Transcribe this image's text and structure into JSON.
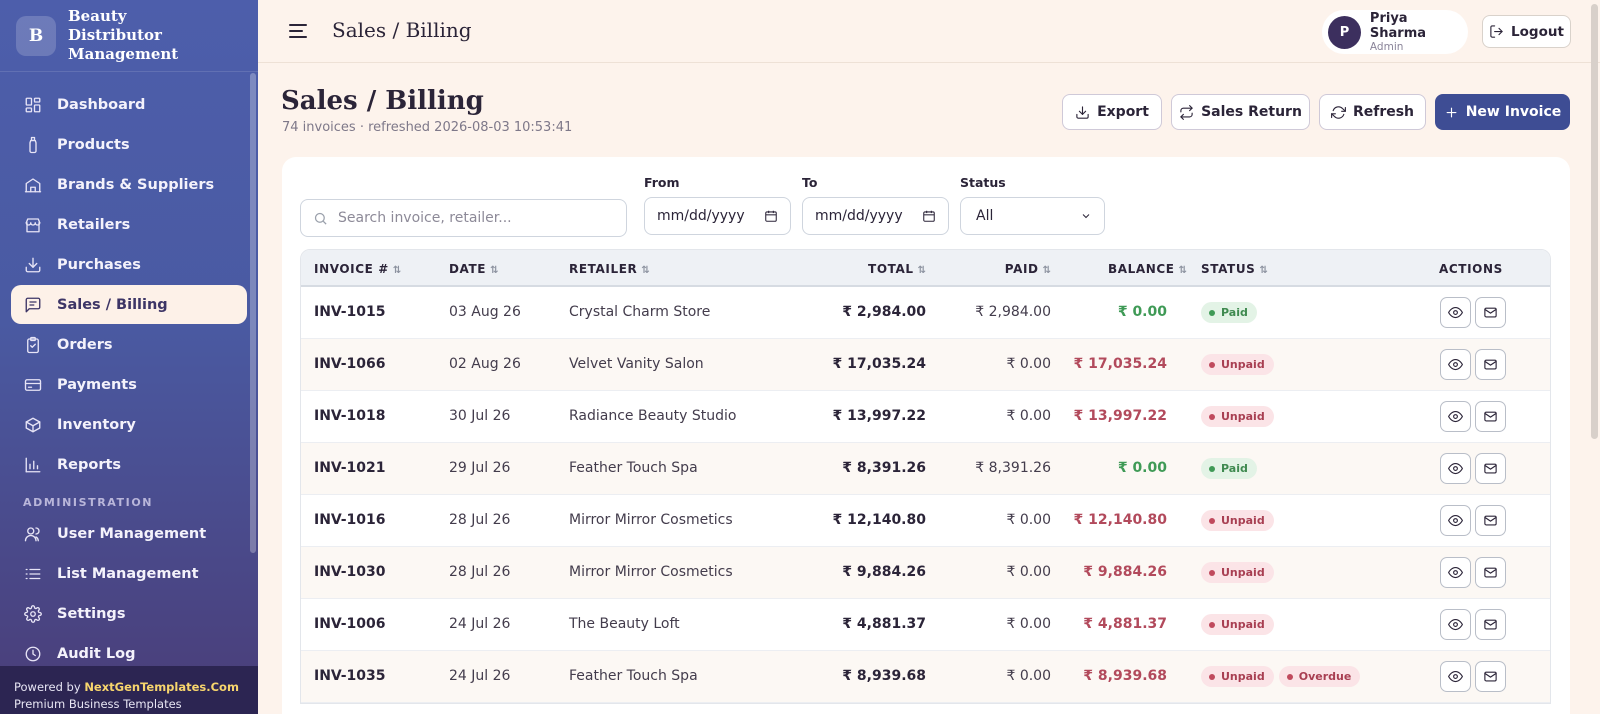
{
  "brand": {
    "logo_letter": "B",
    "name": "Beauty Distributor Management"
  },
  "sidebar": {
    "items": [
      {
        "label": "Dashboard",
        "icon": "grid-icon"
      },
      {
        "label": "Products",
        "icon": "bottle-icon"
      },
      {
        "label": "Brands & Suppliers",
        "icon": "building-icon"
      },
      {
        "label": "Retailers",
        "icon": "store-icon"
      },
      {
        "label": "Purchases",
        "icon": "download-icon"
      },
      {
        "label": "Sales / Billing",
        "icon": "receipt-icon",
        "active": true
      },
      {
        "label": "Orders",
        "icon": "clipboard-icon"
      },
      {
        "label": "Payments",
        "icon": "card-icon"
      },
      {
        "label": "Inventory",
        "icon": "box-icon"
      },
      {
        "label": "Reports",
        "icon": "bar-chart-icon"
      }
    ],
    "section_label": "ADMINISTRATION",
    "admin_items": [
      {
        "label": "User Management",
        "icon": "users-icon"
      },
      {
        "label": "List Management",
        "icon": "list-icon"
      },
      {
        "label": "Settings",
        "icon": "gear-icon"
      },
      {
        "label": "Audit Log",
        "icon": "clock-icon"
      }
    ],
    "powered_prefix": "Powered by",
    "powered_brand": "NextGenTemplates.Com",
    "powered_tagline": "Premium Business Templates"
  },
  "topbar": {
    "title": "Sales / Billing",
    "user": {
      "initial": "P",
      "name": "Priya Sharma",
      "role": "Admin"
    },
    "logout_label": "Logout"
  },
  "page": {
    "title": "Sales / Billing",
    "subtitle": "74 invoices · refreshed 2026-08-03 10:53:41",
    "buttons": {
      "export": "Export",
      "sales_return": "Sales Return",
      "refresh": "Refresh",
      "new_invoice": "New Invoice"
    }
  },
  "filters": {
    "search_placeholder": "Search invoice, retailer...",
    "from_label": "From",
    "from_value": "mm/dd/yyyy",
    "to_label": "To",
    "to_value": "mm/dd/yyyy",
    "status_label": "Status",
    "status_value": "All"
  },
  "table": {
    "columns": {
      "invoice": "INVOICE #",
      "date": "DATE",
      "retailer": "RETAILER",
      "total": "TOTAL",
      "paid": "PAID",
      "balance": "BALANCE",
      "status": "STATUS",
      "actions": "ACTIONS"
    },
    "sort_glyph": "⇅",
    "rows": [
      {
        "invoice": "INV-1015",
        "date": "03 Aug 26",
        "retailer": "Crystal Charm Store",
        "total": "₹ 2,984.00",
        "paid": "₹ 2,984.00",
        "balance": "₹ 0.00",
        "status": [
          "Paid"
        ]
      },
      {
        "invoice": "INV-1066",
        "date": "02 Aug 26",
        "retailer": "Velvet Vanity Salon",
        "total": "₹ 17,035.24",
        "paid": "₹ 0.00",
        "balance": "₹ 17,035.24",
        "status": [
          "Unpaid"
        ]
      },
      {
        "invoice": "INV-1018",
        "date": "30 Jul 26",
        "retailer": "Radiance Beauty Studio",
        "total": "₹ 13,997.22",
        "paid": "₹ 0.00",
        "balance": "₹ 13,997.22",
        "status": [
          "Unpaid"
        ]
      },
      {
        "invoice": "INV-1021",
        "date": "29 Jul 26",
        "retailer": "Feather Touch Spa",
        "total": "₹ 8,391.26",
        "paid": "₹ 8,391.26",
        "balance": "₹ 0.00",
        "status": [
          "Paid"
        ]
      },
      {
        "invoice": "INV-1016",
        "date": "28 Jul 26",
        "retailer": "Mirror Mirror Cosmetics",
        "total": "₹ 12,140.80",
        "paid": "₹ 0.00",
        "balance": "₹ 12,140.80",
        "status": [
          "Unpaid"
        ]
      },
      {
        "invoice": "INV-1030",
        "date": "28 Jul 26",
        "retailer": "Mirror Mirror Cosmetics",
        "total": "₹ 9,884.26",
        "paid": "₹ 0.00",
        "balance": "₹ 9,884.26",
        "status": [
          "Unpaid"
        ]
      },
      {
        "invoice": "INV-1006",
        "date": "24 Jul 26",
        "retailer": "The Beauty Loft",
        "total": "₹ 4,881.37",
        "paid": "₹ 0.00",
        "balance": "₹ 4,881.37",
        "status": [
          "Unpaid"
        ]
      },
      {
        "invoice": "INV-1035",
        "date": "24 Jul 26",
        "retailer": "Feather Touch Spa",
        "total": "₹ 8,939.68",
        "paid": "₹ 0.00",
        "balance": "₹ 8,939.68",
        "status": [
          "Unpaid",
          "Overdue"
        ]
      }
    ]
  },
  "colors": {
    "accent": "#3e4d94",
    "paid": "#3f9a56",
    "due": "#b24a5c"
  }
}
